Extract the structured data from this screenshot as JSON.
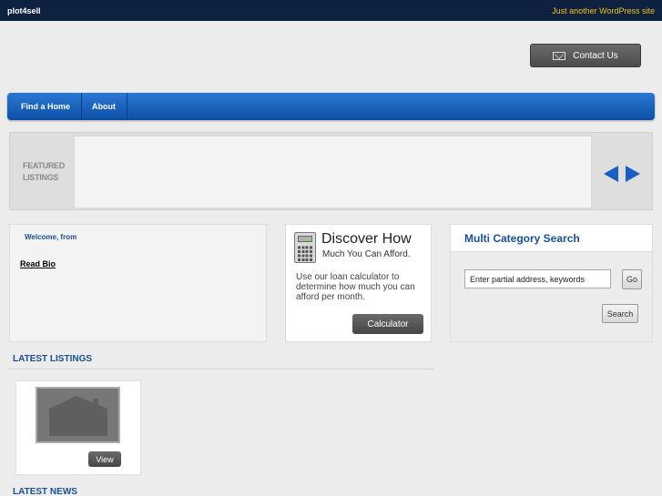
{
  "topbar": {
    "site_name": "plot4sell",
    "tagline": "Just another WordPress site"
  },
  "header": {
    "contact_label": "Contact Us"
  },
  "nav": {
    "items": [
      {
        "label": "Find a Home"
      },
      {
        "label": "About"
      }
    ]
  },
  "featured": {
    "label": "FEATURED LISTINGS"
  },
  "welcome": {
    "title": "Welcome, from",
    "read_bio": "Read Bio"
  },
  "calculator": {
    "heading": "Discover How",
    "subheading": "Much You Can Afford.",
    "description": "Use our loan calculator to determine how much you can afford per month.",
    "button": "Calculator"
  },
  "search": {
    "title": "Multi Category Search",
    "input_value": "Enter partial address, keywords",
    "go_label": "Go",
    "search_label": "Search"
  },
  "latest_listings": {
    "heading": "LATEST LISTINGS",
    "items": [
      {
        "view_label": "View"
      }
    ]
  },
  "latest_news": {
    "heading": "LATEST NEWS"
  },
  "colors": {
    "topbar_bg": "#0f2140",
    "tagline": "#f0c419",
    "nav_blue": "#1a5fc0",
    "heading_blue": "#1a4f8f"
  }
}
